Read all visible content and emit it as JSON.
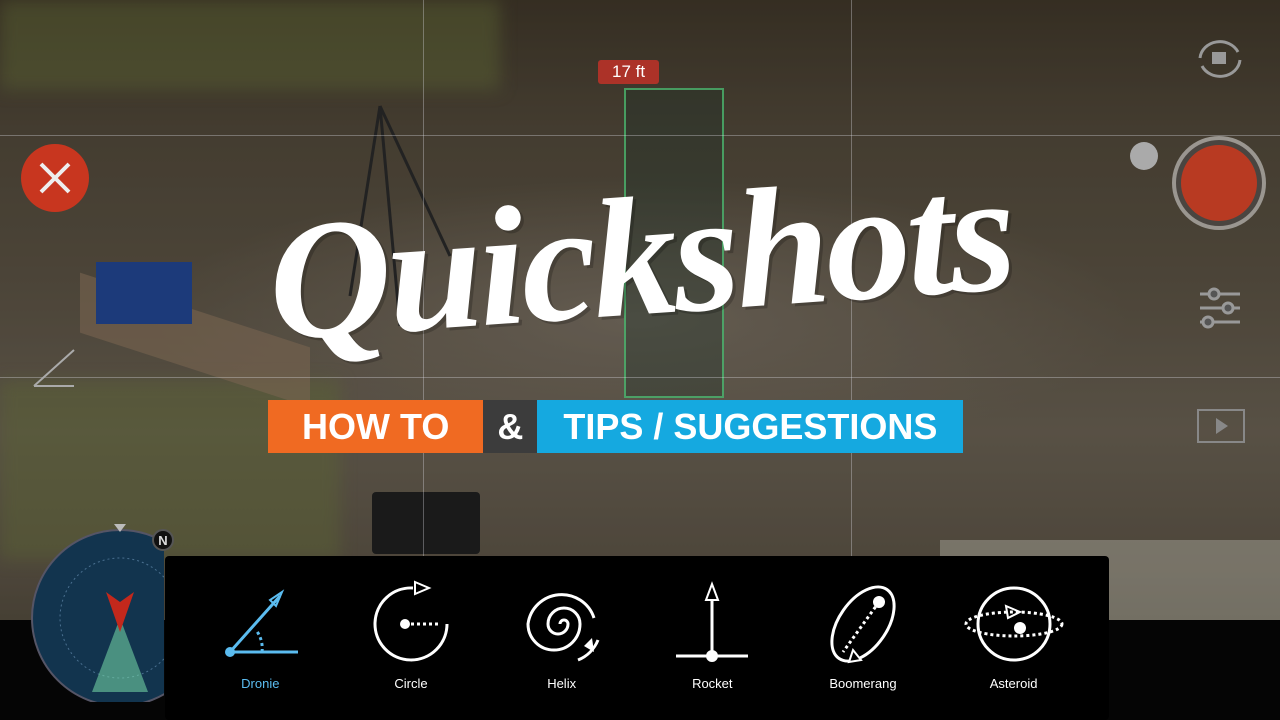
{
  "hud": {
    "distance": "17 ft",
    "compass_north": "N"
  },
  "title": "Quickshots",
  "banner": {
    "left": "HOW TO",
    "amp": "&",
    "right": "TIPS / SUGGESTIONS"
  },
  "colors": {
    "orange": "#f06a22",
    "blue": "#15a9e0",
    "record": "#b83a22",
    "selected": "#5bbcf0"
  },
  "modes": [
    {
      "label": "Dronie",
      "icon": "dronie-icon",
      "selected": true
    },
    {
      "label": "Circle",
      "icon": "circle-icon"
    },
    {
      "label": "Helix",
      "icon": "helix-icon"
    },
    {
      "label": "Rocket",
      "icon": "rocket-icon"
    },
    {
      "label": "Boomerang",
      "icon": "boomerang-icon"
    },
    {
      "label": "Asteroid",
      "icon": "asteroid-icon"
    }
  ]
}
